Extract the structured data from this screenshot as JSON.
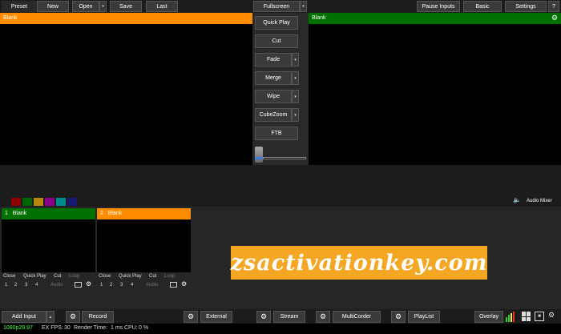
{
  "topbar": {
    "preset": "Preset",
    "new": "New",
    "open": "Open",
    "save": "Save",
    "last": "Last",
    "fullscreen": "Fullscreen",
    "pause_inputs": "Pause Inputs",
    "basic": "Basic",
    "settings": "Settings",
    "help": "?"
  },
  "preview": {
    "title": "Blank",
    "color": "#ff8c00"
  },
  "output": {
    "title": "Blank",
    "color": "#007000"
  },
  "transitions": {
    "quick_play": "Quick Play",
    "cut": "Cut",
    "fade": "Fade",
    "merge": "Merge",
    "wipe": "Wipe",
    "cubezoom": "CubeZoom",
    "ftb": "FTB"
  },
  "color_swatches": [
    "#8b0000",
    "#006400",
    "#b8860b",
    "#8b008b",
    "#008b8b",
    "#191970"
  ],
  "audio_mixer": "Audio Mixer",
  "inputs": [
    {
      "number": "1",
      "title": "Blank",
      "color": "#007000",
      "controls": [
        "Close",
        "Quick Play",
        "Cut",
        "Loop"
      ],
      "nums": [
        "1",
        "2",
        "3",
        "4"
      ],
      "audio": "Audio"
    },
    {
      "number": "2",
      "title": "Blank",
      "color": "#ff8c00",
      "controls": [
        "Close",
        "Quick Play",
        "Cut",
        "Loop"
      ],
      "nums": [
        "1",
        "2",
        "3",
        "4"
      ],
      "audio": "Audio"
    }
  ],
  "watermark": "zsactivationkey.com",
  "bottombar": {
    "add_input": "Add Input",
    "record": "Record",
    "external": "External",
    "stream": "Stream",
    "multicorder": "MultiCorder",
    "playlist": "PlayList",
    "overlay": "Overlay"
  },
  "status": {
    "format": "1080p29.97",
    "ex_fps_label": "EX FPS:",
    "ex_fps": "30",
    "render_label": "Render Time:",
    "render": "1 ms",
    "cpu_label": "CPU:",
    "cpu": "0 %"
  }
}
